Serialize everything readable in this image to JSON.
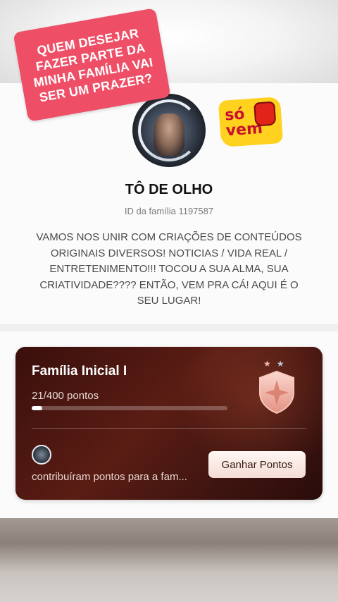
{
  "overlay": {
    "sticker_text": "QUEM DESEJAR\nFAZER PARTE DA\nMINHA FAMÍLIA VAI\nSER UM PRAZER?",
    "emoji_badge_text": "só\nvem",
    "emoji_badge_color": "#ffd21f"
  },
  "family": {
    "name": "TÔ DE OLHO",
    "id_text": "ID da família 1197587",
    "description": "VAMOS NOS UNIR COM CRIAÇÕES DE CONTEÚDOS ORIGINAIS DIVERSOS! NOTICIAS / VIDA REAL / ENTRETENIMENTO!!! TOCOU A SUA ALMA, SUA CRIATIVIDADE???? ENTÃO, VEM PRA CÁ! AQUI É O SEU LUGAR!"
  },
  "level_card": {
    "title": "Família Inicial I",
    "points_text": "21/400 pontos",
    "points_current": 21,
    "points_total": 400,
    "badge_icon": "shield-badge-icon",
    "contributors_text": "contribuíram pontos para a fam...",
    "earn_button_label": "Ganhar Pontos",
    "accent_color": "#5a1d14"
  }
}
